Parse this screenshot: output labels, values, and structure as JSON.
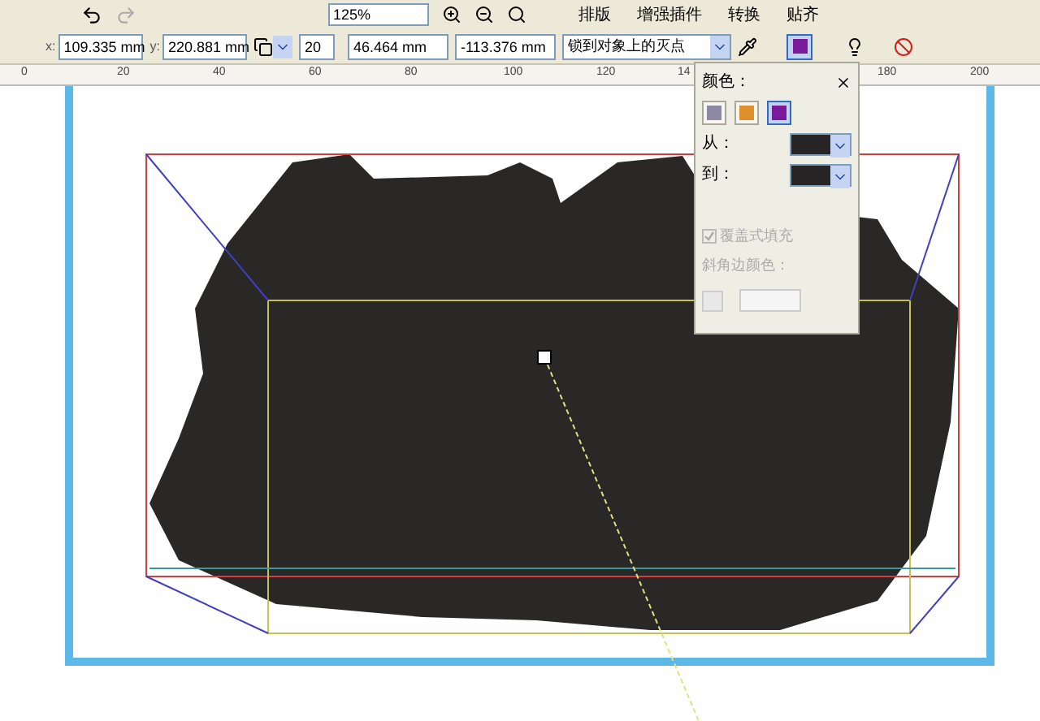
{
  "toolbar": {
    "zoom": "125%",
    "menus": [
      {
        "label": "排版"
      },
      {
        "label": "增强插件"
      },
      {
        "label": "转换"
      },
      {
        "label": "贴齐"
      }
    ]
  },
  "property_bar": {
    "x_label": "x:",
    "x": "109.335 mm",
    "y_label": "y:",
    "y": "220.881 mm",
    "depth": "20",
    "vp_x": "46.464 mm",
    "vp_y": "-113.376 mm",
    "lock": "锁到对象上的灭点"
  },
  "ruler": [
    "0",
    "20",
    "40",
    "60",
    "80",
    "100",
    "120",
    "14",
    "180",
    "200"
  ],
  "color_panel": {
    "title": "颜色：",
    "modes": [
      {
        "kind": "object",
        "selected": false
      },
      {
        "kind": "solid",
        "selected": false
      },
      {
        "kind": "shade",
        "selected": true
      }
    ],
    "from_label": "从：",
    "to_label": "到：",
    "overprint": {
      "label": "覆盖式填充",
      "checked": true,
      "disabled": true
    },
    "bevel_label": "斜角边颜色："
  }
}
